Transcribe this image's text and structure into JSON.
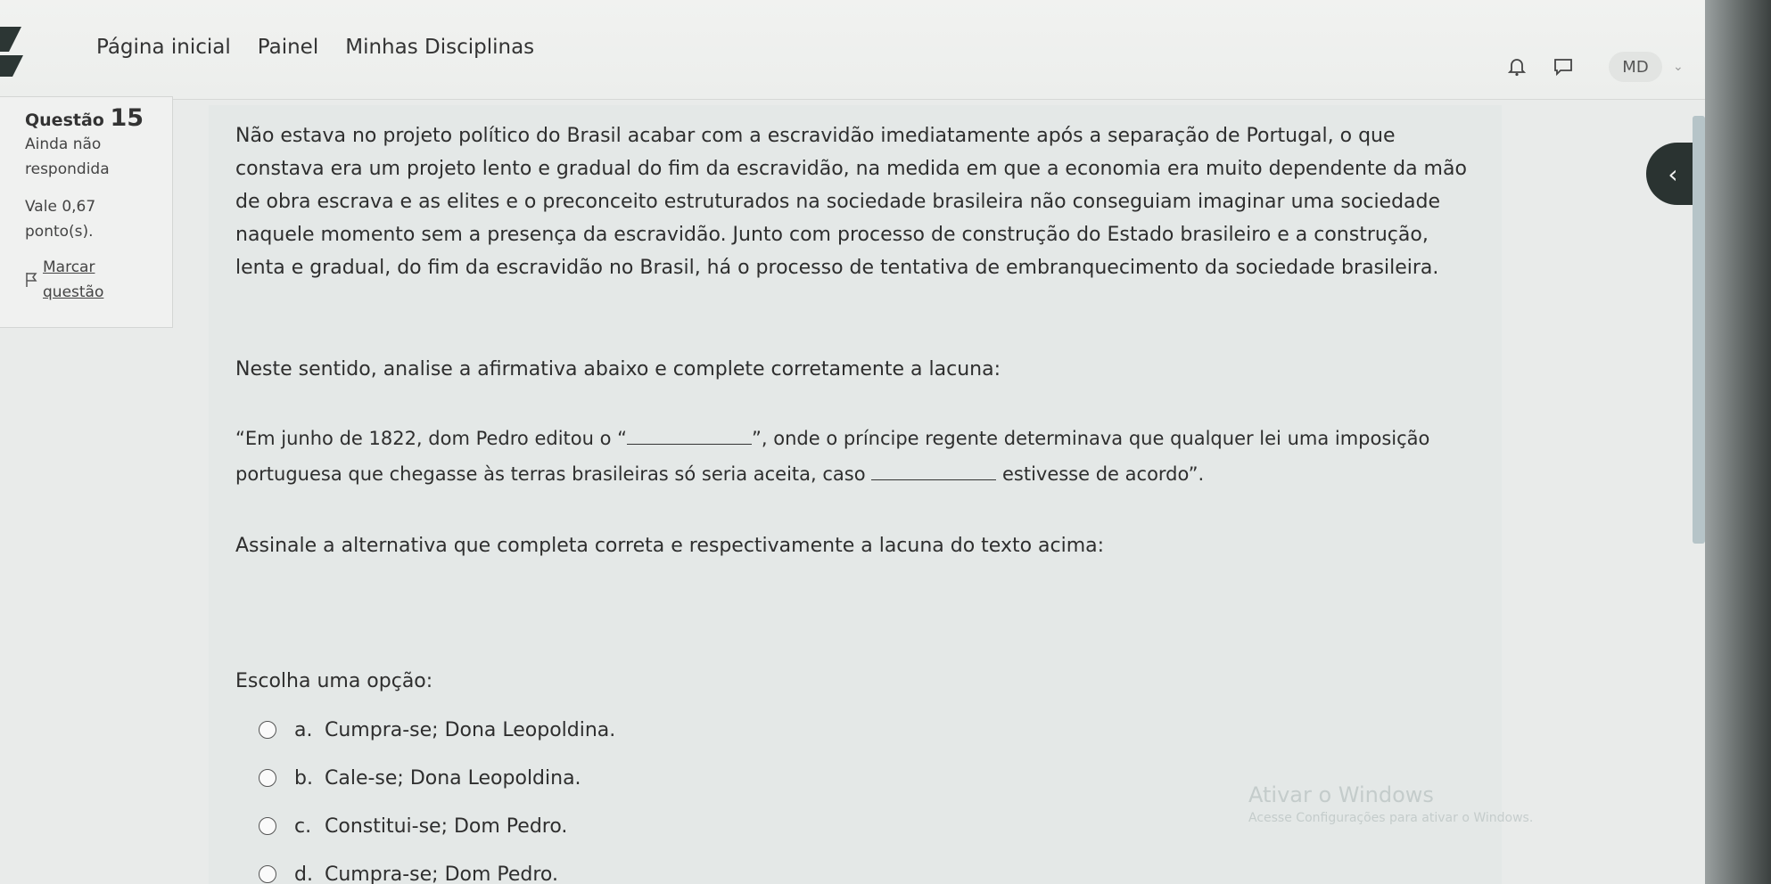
{
  "nav": {
    "links": [
      "Página inicial",
      "Painel",
      "Minhas Disciplinas"
    ],
    "avatar_initials": "MD",
    "icons": [
      "bell-icon",
      "chat-icon",
      "chevron-down-icon"
    ]
  },
  "question_info": {
    "label": "Questão",
    "number": "15",
    "status": "Ainda não respondida",
    "score": "Vale 0,67 ponto(s).",
    "flag_label": "Marcar questão"
  },
  "question": {
    "intro": "Não estava no projeto político do Brasil acabar com a escravidão imediatamente após a separação de Portugal, o que constava era um projeto lento e gradual do fim da escravidão, na medida em que a economia era muito dependente da mão de obra escrava e as elites e o preconceito estruturados na sociedade brasileira não conseguiam imaginar uma sociedade naquele momento sem a presença da escravidão. Junto com processo de construção do Estado brasileiro e a construção, lenta e gradual, do fim da escravidão no Brasil, há o processo de tentativa de embranquecimento da sociedade brasileira.",
    "instruction": "Neste sentido, analise a afirmativa abaixo e complete corretamente a lacuna:",
    "quote_part1": "“Em junho de 1822, dom Pedro editou o “",
    "quote_part2": "”, onde o príncipe regente determinava que qualquer lei uma",
    "quote_part3": "imposição portuguesa que chegasse às terras brasileiras só seria aceita, caso",
    "quote_part4": "estivesse de acordo”.",
    "prompt": "Assinale a alternativa que completa correta e respectivamente a lacuna do texto acima:",
    "choose_label": "Escolha uma opção:",
    "options": [
      {
        "letter": "a.",
        "text": "Cumpra-se; Dona Leopoldina."
      },
      {
        "letter": "b.",
        "text": "Cale-se; Dona Leopoldina."
      },
      {
        "letter": "c.",
        "text": "Constitui-se; Dom Pedro."
      },
      {
        "letter": "d.",
        "text": "Cumpra-se; Dom Pedro."
      }
    ]
  },
  "watermark": {
    "title": "Ativar o Windows",
    "subtitle": "Acesse Configurações para ativar o Windows."
  }
}
